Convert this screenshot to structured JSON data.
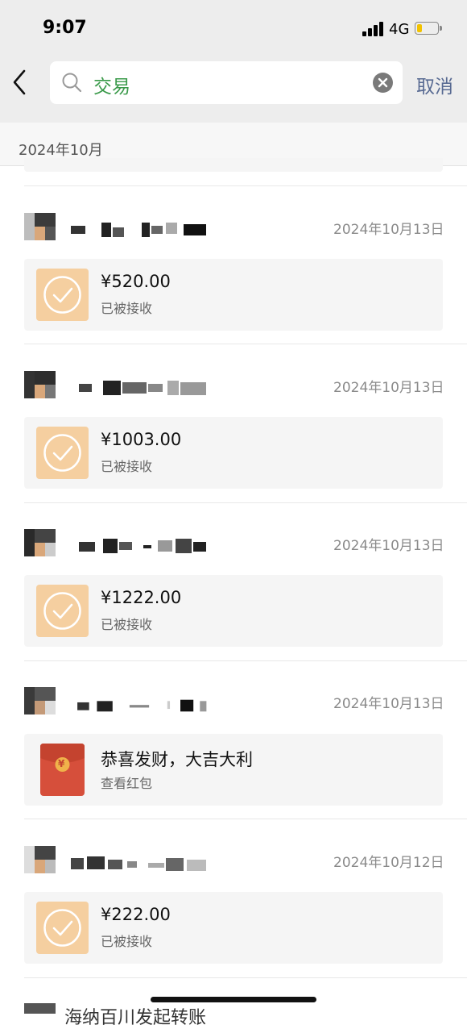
{
  "status_bar": {
    "time": "9:07",
    "network": "4G"
  },
  "search": {
    "query": "交易",
    "cancel_label": "取消"
  },
  "month_header": "2024年10月",
  "items": [
    {
      "date": "2024年10月13日",
      "title": "¥520.00",
      "subtitle": "已被接收",
      "kind": "transfer"
    },
    {
      "date": "2024年10月13日",
      "title": "¥1003.00",
      "subtitle": "已被接收",
      "kind": "transfer"
    },
    {
      "date": "2024年10月13日",
      "title": "¥1222.00",
      "subtitle": "已被接收",
      "kind": "transfer"
    },
    {
      "date": "2024年10月13日",
      "title": "恭喜发财，大吉大利",
      "subtitle": "查看红包",
      "kind": "red-packet",
      "badge": "¥"
    },
    {
      "date": "2024年10月12日",
      "title": "¥222.00",
      "subtitle": "已被接收",
      "kind": "transfer"
    }
  ],
  "bottom_partial_text": "海纳百川发起转账",
  "colors": {
    "topbar": "#ededed",
    "accent_green": "#3a9a4a",
    "cancel": "#586a92",
    "transfer_icon": "#f5cfa0",
    "red_packet": "#d64f3b"
  }
}
